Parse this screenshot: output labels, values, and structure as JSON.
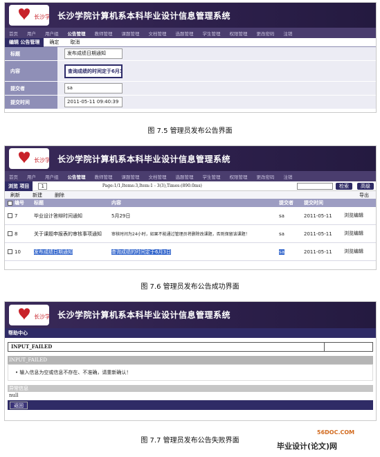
{
  "system_title": "长沙学院计算机系本科毕业设计信息管理系统",
  "logo_text": "长沙学院",
  "nav": [
    "首页",
    "用户",
    "用户组",
    "公告管理",
    "教师管理",
    "课题管理",
    "文档管理",
    "选题管理",
    "学生管理",
    "权限管理",
    "更改密码",
    "注销"
  ],
  "fig1": {
    "toolbar": {
      "tab": "编辑 公告管理",
      "confirm": "确定",
      "cancel": "取消"
    },
    "fields": [
      {
        "label": "标题",
        "value": "发布成绩日期通知"
      },
      {
        "label": "内容",
        "value": "查询成绩的时间定于6月3"
      },
      {
        "label": "提交者",
        "value": "sa"
      },
      {
        "label": "提交时间",
        "value": "2011-05-11 09:40:39"
      }
    ],
    "caption": "图 7.5 管理员发布公告界面"
  },
  "fig2": {
    "toolbar": {
      "tab": "浏览 项目",
      "page": "1",
      "page_info": "Page:1/1,Items:3,Item:1 - 3(3),Times:(890.0ms)",
      "search": "检索",
      "advanced": "高级"
    },
    "actions": {
      "refresh": "刷新",
      "new": "新建",
      "delete": "删除",
      "export": "导出"
    },
    "columns": [
      "编号",
      "标题",
      "内容",
      "提交者",
      "提交时间",
      ""
    ],
    "rows": [
      {
        "id": "7",
        "title": "毕业设计答辩时间通知",
        "content": "5月29日",
        "user": "sa",
        "time": "2011-05-11",
        "ops": "浏览编辑"
      },
      {
        "id": "8",
        "title": "关于课题申报表的审核事项通知",
        "content": "审核时间为24小时，如果不能通过管理员将删除改课题，否则保留该课题！",
        "user": "sa",
        "time": "2011-05-11",
        "ops": "浏览编辑"
      },
      {
        "id": "10",
        "title": "发布成绩日期通知",
        "content": "查询成绩的时间定于6月3日",
        "user": "sa",
        "time": "2011-05-11",
        "ops": "浏览编辑"
      }
    ],
    "caption": "图 7.6 管理员发布公告成功界面"
  },
  "fig3": {
    "help": "帮助中心",
    "error_title": "INPUT_FAILED",
    "error_header": "INPUT_FAILED",
    "error_msg": "• 输入信息为空或信息不存在、不准确，请重新确认！",
    "detail_header": "异常信息",
    "null_text": "null",
    "back": "返回",
    "caption": "图 7.7 管理员发布公告失败界面"
  },
  "watermark": {
    "site": "56DOC.COM",
    "brand": "毕业设计(论文)网"
  }
}
